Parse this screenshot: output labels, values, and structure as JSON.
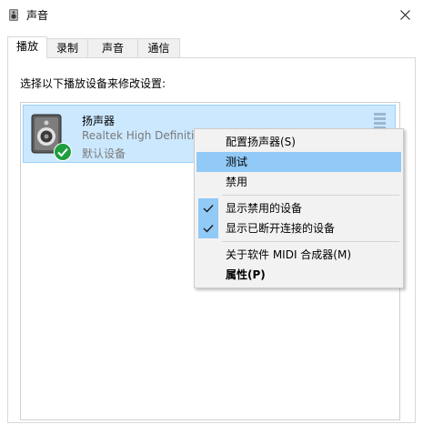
{
  "window": {
    "title": "声音"
  },
  "tabs": [
    {
      "label": "播放",
      "active": true
    },
    {
      "label": "录制",
      "active": false
    },
    {
      "label": "声音",
      "active": false
    },
    {
      "label": "通信",
      "active": false
    }
  ],
  "instruction": "选择以下播放设备来修改设置:",
  "device": {
    "name": "扬声器",
    "driver": "Realtek High Definitio",
    "status": "默认设备",
    "icon": "speaker-icon",
    "badge": "checkmark-icon"
  },
  "context_menu": {
    "items": {
      "configure": "配置扬声器(S)",
      "test": "测试",
      "disable": "禁用",
      "show_disabled": "显示禁用的设备",
      "show_disconnected": "显示已断开连接的设备",
      "about_midi": "关于软件 MIDI 合成器(M)",
      "properties": "属性(P)"
    },
    "checked": {
      "show_disabled": true,
      "show_disconnected": true
    },
    "highlighted": "test"
  },
  "colors": {
    "selection_bg": "#cce8ff",
    "selection_border": "#99d1ff",
    "menu_highlight": "#91c9f7",
    "check_green": "#1e9e3f"
  }
}
